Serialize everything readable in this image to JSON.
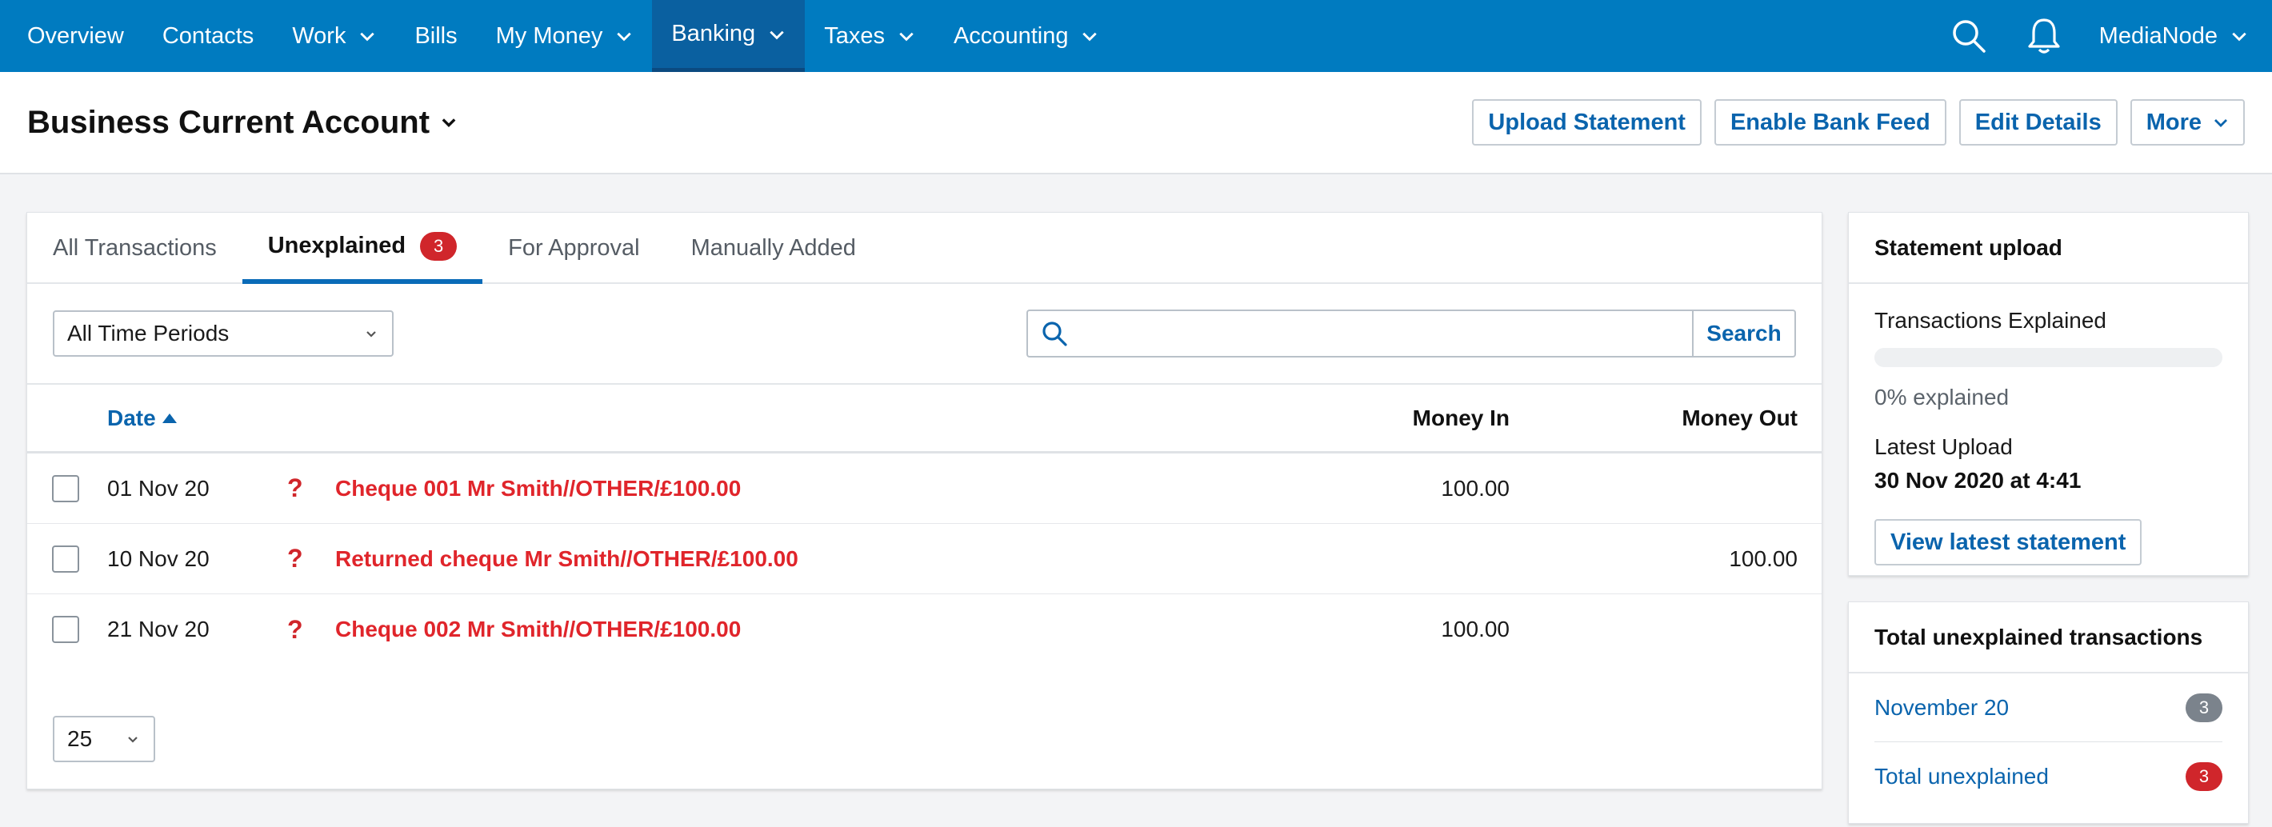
{
  "colors": {
    "nav_bg": "#007bc0",
    "nav_active": "#0a60a0",
    "accent": "#0a64ad",
    "danger": "#d0262b"
  },
  "nav": {
    "items": [
      {
        "label": "Overview",
        "dropdown": false
      },
      {
        "label": "Contacts",
        "dropdown": false
      },
      {
        "label": "Work",
        "dropdown": true
      },
      {
        "label": "Bills",
        "dropdown": false
      },
      {
        "label": "My Money",
        "dropdown": true
      },
      {
        "label": "Banking",
        "dropdown": true,
        "active": true
      },
      {
        "label": "Taxes",
        "dropdown": true
      },
      {
        "label": "Accounting",
        "dropdown": true
      }
    ],
    "icons": [
      "search-icon",
      "bell-icon"
    ],
    "account": "MediaNode"
  },
  "header": {
    "title": "Business Current Account",
    "buttons": {
      "upload": "Upload Statement",
      "bank_feed": "Enable Bank Feed",
      "edit": "Edit Details",
      "more": "More"
    }
  },
  "tabs": [
    {
      "label": "All Transactions"
    },
    {
      "label": "Unexplained",
      "badge": "3",
      "active": true
    },
    {
      "label": "For Approval"
    },
    {
      "label": "Manually Added"
    }
  ],
  "filters": {
    "period": "All Time Periods",
    "search_placeholder": "",
    "search_button": "Search"
  },
  "table": {
    "headers": {
      "date": "Date",
      "money_in": "Money In",
      "money_out": "Money Out"
    },
    "rows": [
      {
        "date": "01 Nov 20",
        "status": "?",
        "description": "Cheque 001 Mr Smith//OTHER/£100.00",
        "money_in": "100.00",
        "money_out": ""
      },
      {
        "date": "10 Nov 20",
        "status": "?",
        "description": "Returned cheque Mr Smith//OTHER/£100.00",
        "money_in": "",
        "money_out": "100.00"
      },
      {
        "date": "21 Nov 20",
        "status": "?",
        "description": "Cheque 002 Mr Smith//OTHER/£100.00",
        "money_in": "100.00",
        "money_out": ""
      }
    ],
    "per_page": "25"
  },
  "statement_upload": {
    "title": "Statement upload",
    "explained_label": "Transactions Explained",
    "explained_fraction": 0,
    "explained_text": "0% explained",
    "latest_label": "Latest Upload",
    "latest_value": "30 Nov 2020 at 4:41",
    "view_button": "View latest statement"
  },
  "unexplained_summary": {
    "title": "Total unexplained transactions",
    "rows": [
      {
        "label": "November 20",
        "count": "3",
        "badge": "grey"
      },
      {
        "label": "Total unexplained",
        "count": "3",
        "badge": "red"
      }
    ]
  }
}
